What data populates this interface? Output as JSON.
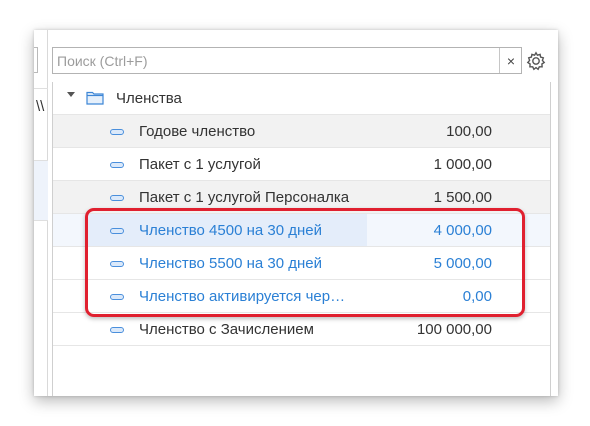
{
  "search": {
    "placeholder": "Поиск (Ctrl+F)",
    "clear_label": "×"
  },
  "left_pane": {
    "column_glyph": "\\\\"
  },
  "tree": {
    "group": {
      "label": "Членства",
      "icon": "folder-icon",
      "expanded": true
    },
    "items": [
      {
        "name": "Годове членство",
        "price": "100,00"
      },
      {
        "name": "Пакет с 1 услугой",
        "price": "1 000,00"
      },
      {
        "name": "Пакет с 1 услугой Персоналка",
        "price": "1 500,00"
      },
      {
        "name": "Членство 4500 на 30 дней",
        "price": "4 000,00"
      },
      {
        "name": "Членство 5500 на 30 дней",
        "price": "5 000,00"
      },
      {
        "name": "Членство активируется чер…",
        "price": "0,00"
      },
      {
        "name": "Членство с Зачислением",
        "price": "100 000,00"
      }
    ]
  },
  "colors": {
    "accent": "#2b80d5",
    "annotation": "#e0202f",
    "item_icon": "#4a8fdc"
  }
}
